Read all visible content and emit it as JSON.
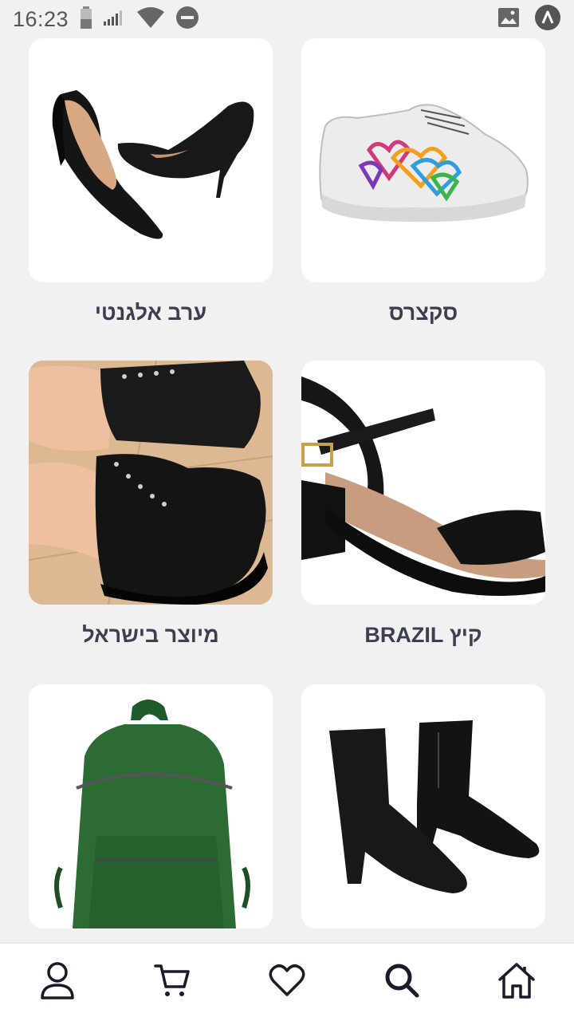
{
  "status_bar": {
    "time": "16:23",
    "left_icons": [
      "battery-icon",
      "signal-icon",
      "wifi-icon",
      "dnd-icon"
    ],
    "right_icons": [
      "image-notification-icon",
      "app-notification-icon"
    ]
  },
  "categories": [
    {
      "label": "ערב אלגנטי",
      "image": "black-pumps-image"
    },
    {
      "label": "סקצרס",
      "image": "sneakers-image"
    },
    {
      "label": "מיוצר בישראל",
      "image": "black-boots-image"
    },
    {
      "label": "קיץ BRAZIL",
      "image": "black-sandal-image"
    },
    {
      "label": "",
      "image": "green-backpack-image"
    },
    {
      "label": "",
      "image": "ankle-boots-image"
    }
  ],
  "bottom_nav": {
    "items": [
      {
        "icon": "profile-icon"
      },
      {
        "icon": "cart-icon"
      },
      {
        "icon": "heart-icon"
      },
      {
        "icon": "search-icon"
      },
      {
        "icon": "home-icon"
      }
    ]
  },
  "colors": {
    "background": "#f1f1f1",
    "card": "#ffffff",
    "label_text": "#3b3f4f",
    "nav_icon": "#1a1a2a"
  }
}
